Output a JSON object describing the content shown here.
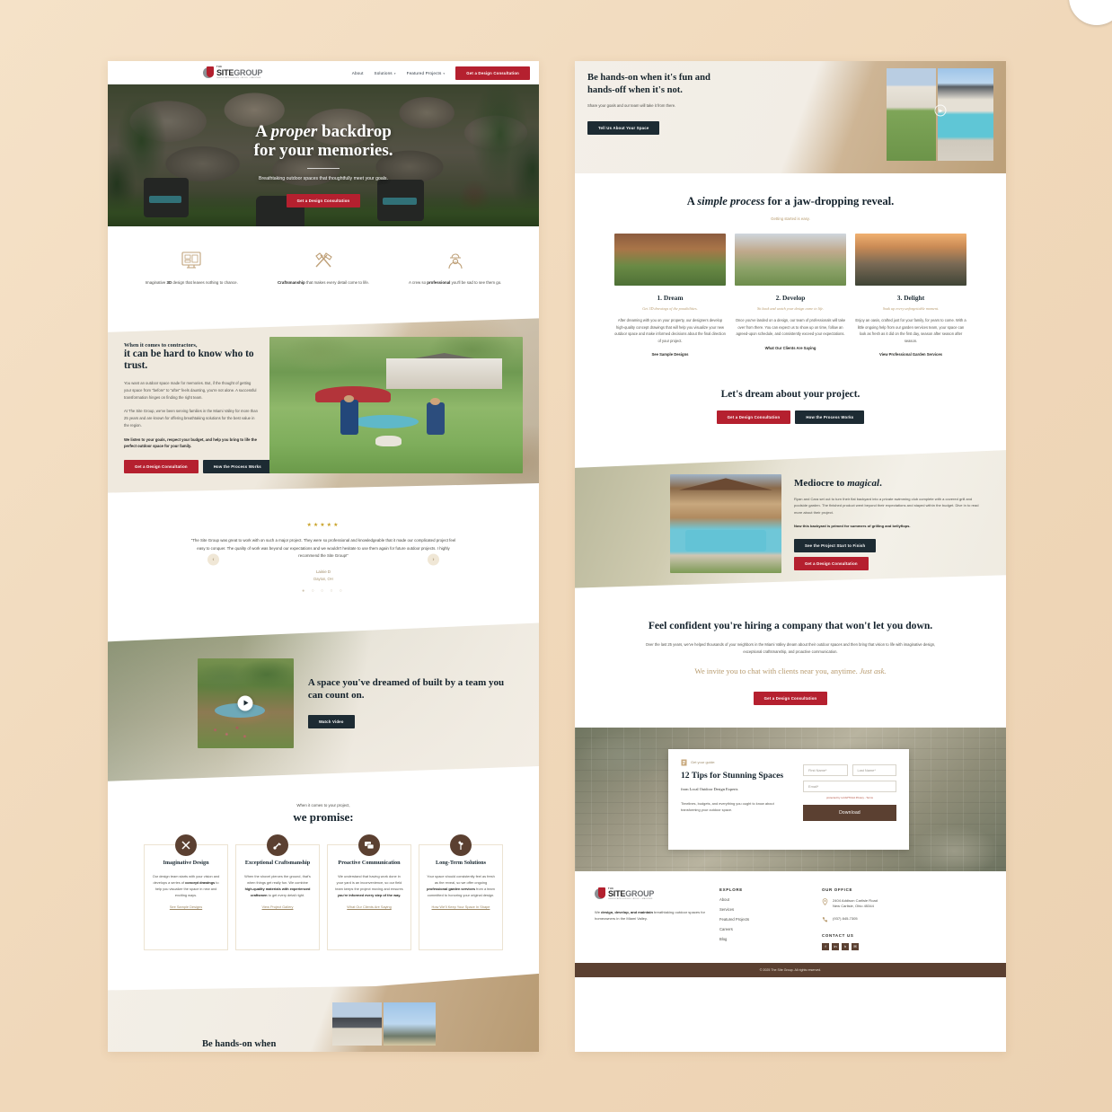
{
  "brand": {
    "logo_the": "THE",
    "logo_site": "SITE",
    "logo_group": "GROUP",
    "logo_sub": "LANDSCAPE DESIGN • BUILD • MAINTAIN",
    "accent_red": "#b5202f",
    "accent_dark": "#1d2b33",
    "accent_brown": "#5b4031",
    "accent_tan": "#b79a6d"
  },
  "nav": {
    "links": [
      {
        "label": "About",
        "caret": false
      },
      {
        "label": "Solutions",
        "caret": true
      },
      {
        "label": "Featured Projects",
        "caret": true
      }
    ],
    "cta": "Get a Design Consultation"
  },
  "hero": {
    "title_line1_pre": "A ",
    "title_line1_em": "proper",
    "title_line1_post": " backdrop",
    "title_line2": "for your memories.",
    "subtitle": "Breathtaking outdoor spaces that thoughtfully meet your goals.",
    "cta": "Get a Design Consultation"
  },
  "features": [
    {
      "icon": "monitor-3d-icon",
      "text_pre": "Imaginative ",
      "text_bold": "3D",
      "text_post": " design that leaves nothing to chance."
    },
    {
      "icon": "tools-icon",
      "text_pre": "",
      "text_bold": "Craftsmanship",
      "text_post": " that makes every detail come to life."
    },
    {
      "icon": "worker-icon",
      "text_pre": "A crew so ",
      "text_bold": "professional",
      "text_post": " you'll be sad to see them go."
    }
  ],
  "trust": {
    "eyebrow": "When it comes to contractors,",
    "heading": "it can be hard to know who to trust.",
    "para1": "You want an outdoor space made for memories. But, if the thought of getting your space from “before” to “after” feels daunting, you're not alone. A successful transformation hinges on finding the right team.",
    "para2": "At The Site Group, we've been serving families in the Miami Valley for more than 25 years and are known for offering breathtaking solutions for the best value in the region.",
    "para3": "We listen to your goals, respect your budget, and help you bring to life the perfect outdoor space for your family.",
    "btn_primary": "Get a Design Consultation",
    "btn_secondary": "How the Process Works"
  },
  "testimonial": {
    "stars": "★★★★★",
    "quote": "“The Site Group was great to work with on such a major project. They were so professional and knowledgeable that it made our complicated project feel easy to conquer. The quality of work was beyond our expectations and we wouldn't hesitate to use them again for future outdoor projects. I highly recommend the Site Group!”",
    "name": "Lainie D",
    "location": "Dayton, OH",
    "dots": "● ○ ○ ○ ○",
    "prev": "‹",
    "next": "›"
  },
  "video": {
    "heading": "A space you've dreamed of built by a team you can count on.",
    "cta": "Watch Video",
    "play_icon": "play-icon"
  },
  "promise": {
    "eyebrow": "When it comes to your project,",
    "heading": "we promise:",
    "cards": [
      {
        "icon": "tools-circle-icon",
        "title": "Imaginative Design",
        "body_pre": "Our design team starts with your vision and develops a series of ",
        "body_bold": "concept drawings",
        "body_post": " to help you visualize the space in new and exciting ways.",
        "link": "See Sample Designs"
      },
      {
        "icon": "trowel-circle-icon",
        "title": "Exceptional Craftsmanship",
        "body_pre": "When the shovel pierces the ground, that's when things get really fun. We combine ",
        "body_bold": "high-quality materials with experienced craftsmen",
        "body_post": " to get every detail right.",
        "link": "View Project Gallery"
      },
      {
        "icon": "chat-circle-icon",
        "title": "Proactive Communication",
        "body_pre": "We understand that having work done in your yard is an inconvenience, so our field team keeps the project moving and ensures ",
        "body_bold": "you're informed every step of the way.",
        "body_post": "",
        "link": "What Our Clients Are Saying"
      },
      {
        "icon": "plant-circle-icon",
        "title": "Long-Term Solutions",
        "body_pre": "Your space should consistently feel as fresh as the reveal, so we offer ongoing ",
        "body_bold": "professional garden services",
        "body_post": " from a team committed to honoring your original design.",
        "link": "How We'll Keep Your Space In Shape"
      }
    ]
  },
  "hands": {
    "heading": "Be hands-on when it's fun and hands-off when it's not.",
    "subtitle": "Share your goals and our team will take it from there.",
    "cta": "Tell Us About Your Space",
    "play_icon": "play-icon"
  },
  "process": {
    "heading_pre": "A ",
    "heading_em": "simple process",
    "heading_post": " for a jaw-dropping reveal.",
    "eyebrow": "Getting started is easy.",
    "steps": [
      {
        "image": "patio-firepit-photo",
        "title": "1. Dream",
        "subtitle": "Get 3D drawings of the possibilities.",
        "body": "After dreaming with you on your property, our designers develop high-quality concept drawings that will help you visualize your new outdoor space and make informed decisions about the final direction of your project.",
        "link": "See Sample Designs"
      },
      {
        "image": "construction-build-photo",
        "title": "2. Develop",
        "subtitle": "Sit back and watch your design come to life.",
        "body": "Once you've landed on a design, our team of professionals will take over from there. You can expect us to show up on time, follow an agreed-upon schedule, and consistently exceed your expectations.",
        "link": "What Our Clients Are Saying"
      },
      {
        "image": "evening-patio-photo",
        "title": "3. Delight",
        "subtitle": "Soak up every unforgettable moment.",
        "body": "Enjoy an oasis, crafted just for your family, for years to come. With a little ongoing help from our garden services team, your space can look as fresh as it did on the first day, season after season after season.",
        "link": "View Professional Garden Services"
      }
    ]
  },
  "dream": {
    "heading": "Let's dream about your project.",
    "btn_primary": "Get a Design Consultation",
    "btn_secondary": "How the Process Works"
  },
  "mediocre": {
    "image": "pool-house-photo",
    "heading_pre": "Mediocre to ",
    "heading_em": "magical",
    "heading_post": ".",
    "body": "Ryan and Cara set out to turn their flat backyard into a private swimming club complete with a covered grill and poolside garden. The finished product went beyond their expectations and stayed within the budget. Dive in to read more about their project.",
    "body_bold": "Now this backyard is primed for summers of grilling and bellyflops.",
    "btn_primary": "See the Project Start to Finish",
    "btn_secondary": "Get a Design Consultation"
  },
  "confident": {
    "heading": "Feel confident you're hiring a company that won't let you down.",
    "body": "Over the last 25 years, we've helped thousands of your neighbors in the Miami Valley dream about their outdoor spaces and then bring that vision to life with imaginative design, exceptional craftsmanship, and proactive communication.",
    "tan_pre": "We invite you to chat with clients near you, anytime. ",
    "tan_em": "Just ask.",
    "cta": "Get a Design Consultation"
  },
  "guide": {
    "eyebrow": "Get your guide:",
    "eyebrow_icon": "document-icon",
    "heading": "12 Tips for Stunning Spaces",
    "subheading": "from Local Outdoor Design Experts",
    "body": "Timelines, budgets, and everything you ought to know about transforming your outdoor space.",
    "fields": {
      "first_name": "First Name*",
      "last_name": "Last Name*",
      "email": "Email*"
    },
    "captcha": "protected by reCAPTCHA Privacy - Terms",
    "submit": "Download"
  },
  "footer": {
    "tagline_pre": "We ",
    "tagline_bold": "design, develop, and maintain",
    "tagline_post": " breathtaking outdoor spaces for homeowners in the Miami Valley.",
    "explore_heading": "EXPLORE",
    "explore_links": [
      "About",
      "Services",
      "Featured Projects",
      "Careers",
      "Blog"
    ],
    "office_heading": "OUR OFFICE",
    "address_line1": "2404 Addison Carlisle Road",
    "address_line2": "New Carlisle, Ohio 45344",
    "phone": "(937) 845-7305",
    "contact_heading": "CONTACT US",
    "socials": [
      "f",
      "in",
      "h",
      "✉"
    ],
    "copyright": "© 2025 The Site Group. All rights reserved."
  },
  "peek": {
    "heading": "Be hands-on when"
  }
}
